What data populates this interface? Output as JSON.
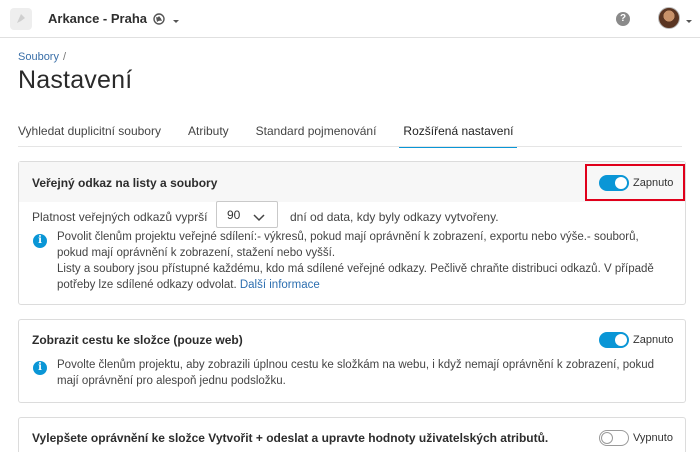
{
  "header": {
    "account_name": "Arkance - Praha",
    "help_symbol": "?"
  },
  "breadcrumb": {
    "parent": "Soubory",
    "separator": "/"
  },
  "page": {
    "title": "Nastavení"
  },
  "tabs": [
    {
      "label": "Vyhledat duplicitní soubory",
      "active": false
    },
    {
      "label": "Atributy",
      "active": false
    },
    {
      "label": "Standard pojmenování",
      "active": false
    },
    {
      "label": "Rozšířená nastavení",
      "active": true
    }
  ],
  "sections": {
    "public_link": {
      "title": "Veřejný odkaz na listy a soubory",
      "toggle_state": "on",
      "toggle_label": "Zapnuto",
      "validity_label": "Platnost veřejných odkazů vyprší",
      "validity_value": "90",
      "validity_suffix": "dní od data, kdy byly odkazy vytvořeny.",
      "info_line1": "Povolit členům projektu veřejné sdílení:- výkresů, pokud mají oprávnění k zobrazení, exportu nebo výše.- souborů,",
      "info_line2": "pokud mají oprávnění k zobrazení, stažení nebo vyšší.",
      "info_line3": "Listy a soubory jsou přístupné každému, kdo má sdílené veřejné odkazy. Pečlivě chraňte distribuci odkazů. V případě",
      "info_line4": "potřeby lze sdílené odkazy odvolat.",
      "more_info_link": "Další informace"
    },
    "folder_path": {
      "title": "Zobrazit cestu ke složce (pouze web)",
      "toggle_state": "on",
      "toggle_label": "Zapnuto",
      "info_line1": "Povolte členům projektu, aby zobrazili úplnou cestu ke složkám na webu, i když nemají oprávnění k zobrazení, pokud",
      "info_line2": "mají oprávnění pro alespoň jednu podsložku."
    },
    "folder_permission": {
      "title": "Vylepšete oprávnění ke složce Vytvořit + odeslat a upravte hodnoty uživatelských atributů.",
      "toggle_state": "off",
      "toggle_label": "Vypnuto"
    }
  },
  "colors": {
    "accent": "#0a96d6",
    "link": "#2d6fb0",
    "highlight": "#e0001b"
  },
  "icons": [
    "app-logo-icon",
    "globe-icon",
    "chevron-down-icon",
    "help-icon",
    "avatar",
    "info-icon"
  ]
}
